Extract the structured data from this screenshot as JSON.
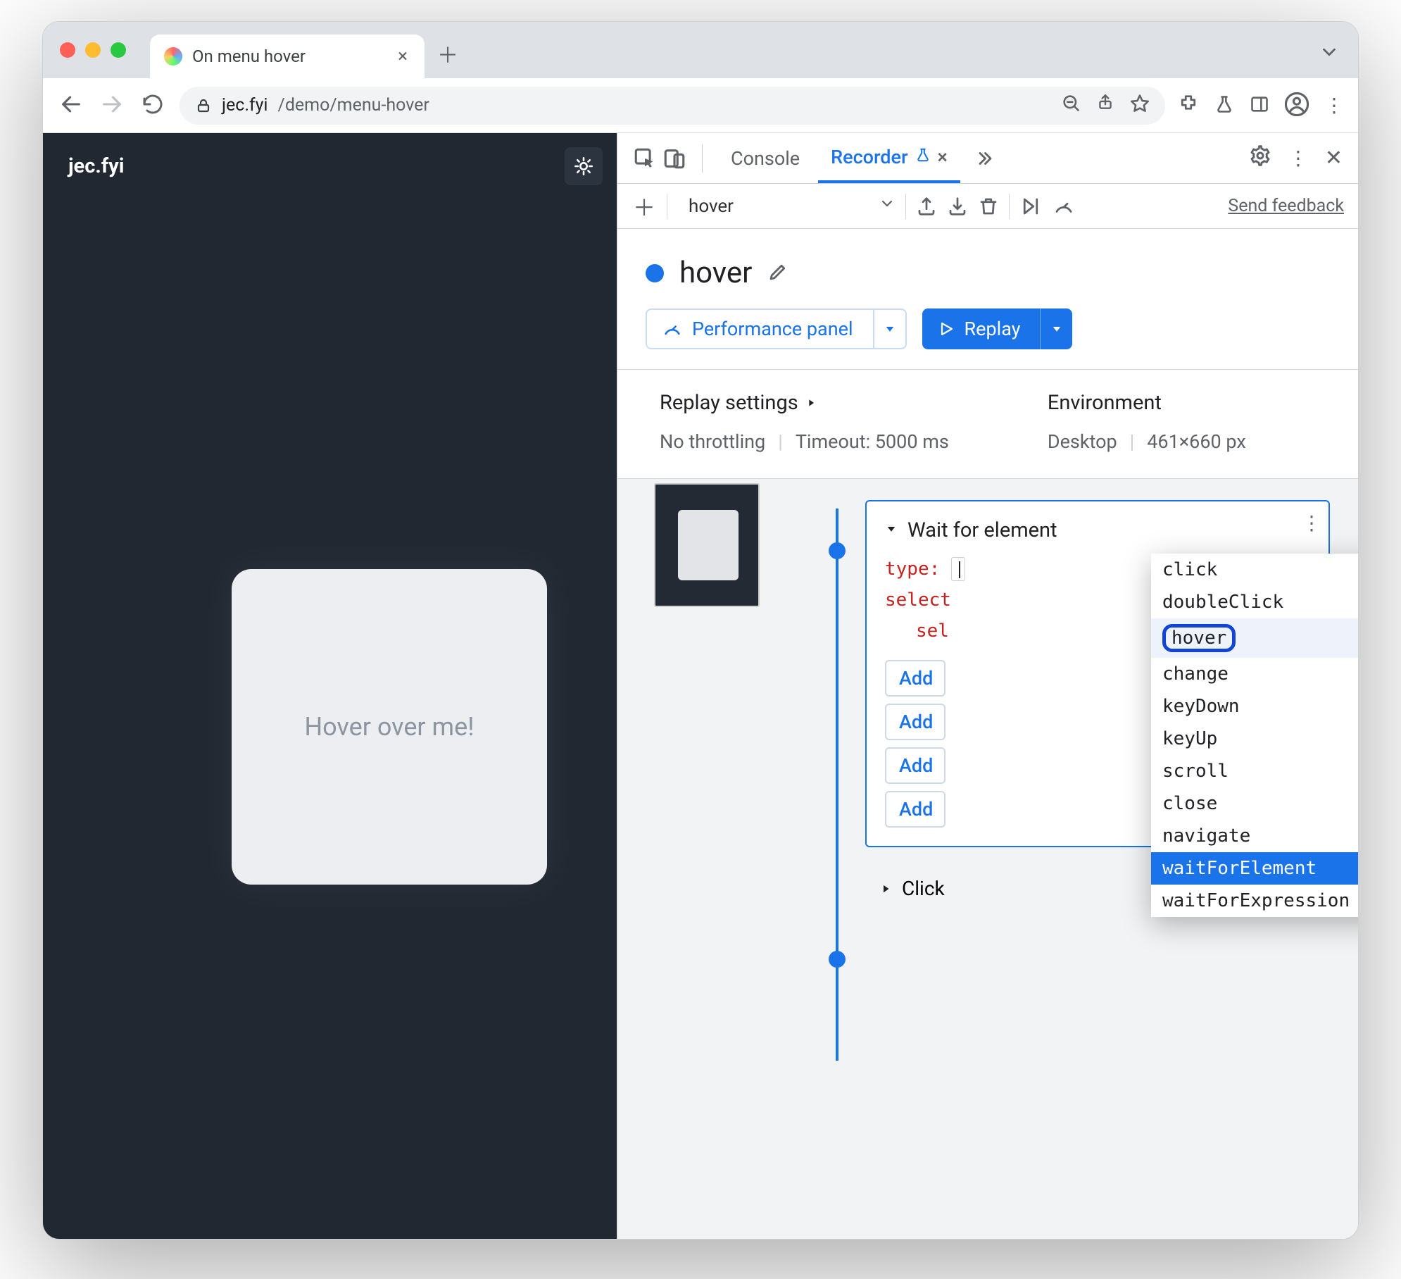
{
  "tab": {
    "title": "On menu hover"
  },
  "url": {
    "domain": "jec.fyi",
    "path": "/demo/menu-hover"
  },
  "page": {
    "brand": "jec.fyi",
    "card": "Hover over me!",
    "thumb_label": "Hover over me!"
  },
  "devtools": {
    "tabs": {
      "console": "Console",
      "recorder": "Recorder"
    },
    "toolbar": {
      "recording_name": "hover",
      "feedback": "Send feedback"
    },
    "title": "hover",
    "buttons": {
      "perf": "Performance panel",
      "replay": "Replay"
    },
    "settings": {
      "replay_h": "Replay settings",
      "throttling": "No throttling",
      "timeout": "Timeout: 5000 ms",
      "env_h": "Environment",
      "device": "Desktop",
      "viewport": "461×660 px"
    },
    "step": {
      "title": "Wait for element",
      "type": "type:",
      "selector": "select",
      "sel": "sel",
      "add": [
        "Add",
        "Add",
        "Add",
        "Add"
      ]
    },
    "click_step": "Click",
    "type_options": [
      "click",
      "doubleClick",
      "hover",
      "change",
      "keyDown",
      "keyUp",
      "scroll",
      "close",
      "navigate",
      "waitForElement",
      "waitForExpression"
    ]
  }
}
